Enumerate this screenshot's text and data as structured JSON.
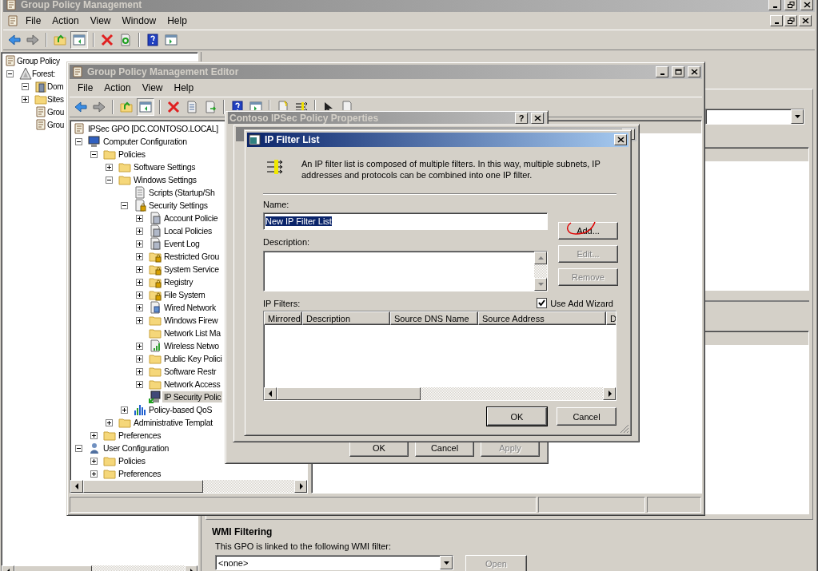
{
  "main_window": {
    "title": "Group Policy Management",
    "menu": [
      "File",
      "Action",
      "View",
      "Window",
      "Help"
    ],
    "tree": [
      {
        "label": "Group Policy",
        "kind": "scroll",
        "selected": false,
        "children": [
          {
            "label": "Forest:",
            "kind": "forest",
            "expanded": true,
            "selected": false,
            "children": [
              {
                "label": "Dom",
                "kind": "domain",
                "expanded": true,
                "selected": false
              },
              {
                "label": "Sites",
                "kind": "folder",
                "expanded": false,
                "selected": false
              },
              {
                "label": "Grou",
                "kind": "scroll",
                "selected": false
              },
              {
                "label": "Grou",
                "kind": "scroll",
                "selected": false
              }
            ]
          }
        ]
      }
    ],
    "wmi": {
      "heading": "WMI Filtering",
      "text": "This GPO is linked to the following WMI filter:",
      "filter": "<none>",
      "open_button": {
        "label": "Open",
        "disabled": true
      }
    }
  },
  "editor_window": {
    "title": "Group Policy Management Editor",
    "menu": [
      "File",
      "Action",
      "View",
      "Help"
    ],
    "tree": [
      {
        "label": "IPSec GPO [DC.CONTOSO.LOCAL]",
        "kind": "scroll",
        "selected": false,
        "children": [
          {
            "label": "Computer Configuration",
            "kind": "computer",
            "expanded": true,
            "selected": false,
            "children": [
              {
                "label": "Policies",
                "kind": "folder",
                "expanded": true,
                "selected": false,
                "children": [
                  {
                    "label": "Software Settings",
                    "kind": "folder",
                    "expanded": false,
                    "selected": false
                  },
                  {
                    "label": "Windows Settings",
                    "kind": "folder",
                    "expanded": true,
                    "selected": false,
                    "children": [
                      {
                        "label": "Scripts (Startup/Sh",
                        "kind": "script",
                        "selected": false
                      },
                      {
                        "label": "Security Settings",
                        "kind": "secure-doc",
                        "expanded": true,
                        "selected": false,
                        "children": [
                          {
                            "label": "Account Policie",
                            "kind": "server-doc",
                            "expanded": false,
                            "selected": false
                          },
                          {
                            "label": "Local Policies",
                            "kind": "server-doc",
                            "expanded": false,
                            "selected": false
                          },
                          {
                            "label": "Event Log",
                            "kind": "server-doc",
                            "expanded": false,
                            "selected": false
                          },
                          {
                            "label": "Restricted Grou",
                            "kind": "locked-folder",
                            "expanded": false,
                            "selected": false
                          },
                          {
                            "label": "System Service",
                            "kind": "locked-folder",
                            "expanded": false,
                            "selected": false
                          },
                          {
                            "label": "Registry",
                            "kind": "locked-folder",
                            "expanded": false,
                            "selected": false
                          },
                          {
                            "label": "File System",
                            "kind": "locked-folder",
                            "expanded": false,
                            "selected": false
                          },
                          {
                            "label": "Wired Network",
                            "kind": "network-doc",
                            "expanded": false,
                            "selected": false
                          },
                          {
                            "label": "Windows Firew",
                            "kind": "folder",
                            "expanded": false,
                            "selected": false
                          },
                          {
                            "label": "Network List Ma",
                            "kind": "folder",
                            "selected": false
                          },
                          {
                            "label": "Wireless Netwo",
                            "kind": "signal",
                            "expanded": false,
                            "selected": false
                          },
                          {
                            "label": "Public Key Polici",
                            "kind": "folder",
                            "expanded": false,
                            "selected": false
                          },
                          {
                            "label": "Software Restr",
                            "kind": "folder",
                            "expanded": false,
                            "selected": false
                          },
                          {
                            "label": "Network Access",
                            "kind": "folder",
                            "expanded": false,
                            "selected": false
                          },
                          {
                            "label": "IP Security Polic",
                            "kind": "ipsec",
                            "selected": true
                          }
                        ]
                      },
                      {
                        "label": "Policy-based QoS",
                        "kind": "chart",
                        "expanded": false,
                        "selected": false
                      }
                    ]
                  },
                  {
                    "label": "Administrative Templat",
                    "kind": "folder",
                    "expanded": false,
                    "selected": false
                  }
                ]
              },
              {
                "label": "Preferences",
                "kind": "folder",
                "expanded": false,
                "selected": false
              }
            ]
          },
          {
            "label": "User Configuration",
            "kind": "user",
            "expanded": true,
            "selected": false,
            "children": [
              {
                "label": "Policies",
                "kind": "folder",
                "expanded": false,
                "selected": false
              },
              {
                "label": "Preferences",
                "kind": "folder",
                "expanded": false,
                "selected": false
              }
            ]
          }
        ]
      }
    ]
  },
  "properties_dialog": {
    "title": "Contoso IPSec Policy Properties",
    "help_button": "?",
    "buttons": [
      {
        "label": "OK",
        "disabled": false
      },
      {
        "label": "Cancel",
        "disabled": false
      },
      {
        "label": "Apply",
        "disabled": true
      }
    ]
  },
  "filter_dialog": {
    "title": "IP Filter List",
    "intro": "An IP filter list is composed of multiple filters. In this way, multiple subnets, IP addresses and protocols can be combined into one IP filter.",
    "name_label": "Name:",
    "name_value": "New IP Filter List",
    "name_text_selected": true,
    "description_label": "Description:",
    "side_buttons": [
      {
        "label": "Add...",
        "disabled": false
      },
      {
        "label": "Edit...",
        "disabled": true
      },
      {
        "label": "Remove",
        "disabled": true
      }
    ],
    "filters_label": "IP Filters:",
    "use_wizard": {
      "label": "Use Add Wizard",
      "checked": true
    },
    "columns": [
      "Mirrored",
      "Description",
      "Source DNS Name",
      "Source Address",
      "D"
    ],
    "buttons": [
      {
        "label": "OK",
        "default": true
      },
      {
        "label": "Cancel",
        "default": false
      }
    ]
  }
}
